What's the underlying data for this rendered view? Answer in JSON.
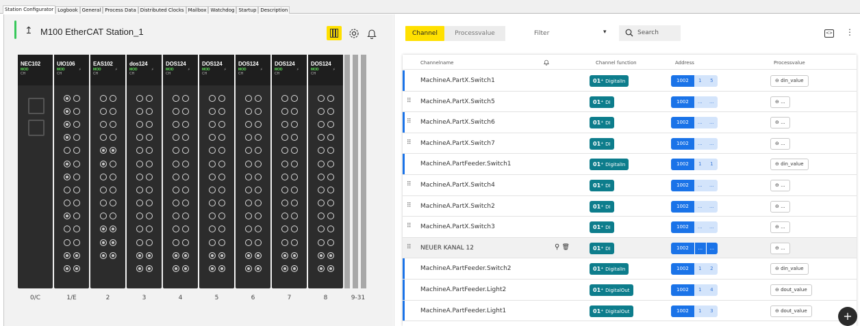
{
  "tabs": [
    "Station Configurator",
    "Logbook",
    "General",
    "Process Data",
    "Distributed Clocks",
    "Mailbox",
    "Watchdog",
    "Startup",
    "Description"
  ],
  "station": {
    "title": "M100 EtherCAT Station_1"
  },
  "modules": [
    {
      "name": "NEC102",
      "mod": "MOD",
      "ch": "CH",
      "slot": "0/C",
      "kind": "coupler"
    },
    {
      "name": "UIO106",
      "mod": "MOD",
      "ch": "CH",
      "slot": "1/E",
      "leds": [
        1,
        0,
        1,
        0,
        1,
        0,
        1,
        0,
        0,
        0,
        1,
        0,
        1,
        0,
        0,
        0,
        0,
        0,
        1,
        0,
        0,
        0,
        0,
        0,
        1,
        1,
        1,
        1
      ]
    },
    {
      "name": "EAS102",
      "mod": "MOD",
      "ch": "CH",
      "slot": "2",
      "leds": [
        0,
        0,
        0,
        0,
        0,
        0,
        0,
        0,
        1,
        1,
        1,
        0,
        0,
        0,
        0,
        0,
        0,
        0,
        0,
        0,
        1,
        1,
        1,
        1,
        1,
        1
      ]
    },
    {
      "name": "dos124",
      "mod": "MOD",
      "ch": "CH",
      "slot": "3",
      "leds": [
        0,
        0,
        0,
        0,
        0,
        0,
        0,
        0,
        0,
        0,
        0,
        0,
        0,
        0,
        0,
        0,
        0,
        0,
        0,
        0,
        0,
        0,
        0,
        0,
        1,
        1,
        1,
        1
      ]
    },
    {
      "name": "DOS124",
      "mod": "MOD",
      "ch": "CH",
      "slot": "4",
      "leds": [
        0,
        0,
        0,
        0,
        0,
        0,
        0,
        0,
        0,
        0,
        0,
        0,
        0,
        0,
        0,
        0,
        0,
        0,
        0,
        0,
        0,
        0,
        0,
        0,
        1,
        1,
        1,
        1
      ]
    },
    {
      "name": "DOS124",
      "mod": "MOD",
      "ch": "CH",
      "slot": "5",
      "leds": [
        0,
        0,
        0,
        0,
        0,
        0,
        0,
        0,
        0,
        0,
        0,
        0,
        0,
        0,
        0,
        0,
        0,
        0,
        0,
        0,
        0,
        0,
        0,
        0,
        1,
        1,
        1,
        1
      ]
    },
    {
      "name": "DOS124",
      "mod": "MOD",
      "ch": "CH",
      "slot": "6",
      "leds": [
        0,
        0,
        0,
        0,
        0,
        0,
        0,
        0,
        0,
        0,
        0,
        0,
        0,
        0,
        0,
        0,
        0,
        0,
        0,
        0,
        0,
        0,
        0,
        0,
        1,
        1,
        1,
        1
      ]
    },
    {
      "name": "DOS124",
      "mod": "MOD",
      "ch": "CH",
      "slot": "7",
      "leds": [
        0,
        0,
        0,
        0,
        0,
        0,
        0,
        0,
        0,
        0,
        0,
        0,
        0,
        0,
        0,
        0,
        0,
        0,
        0,
        0,
        0,
        0,
        0,
        0,
        1,
        1,
        1,
        1
      ]
    },
    {
      "name": "DOS124",
      "mod": "MOD",
      "ch": "CH",
      "slot": "8",
      "leds": [
        0,
        0,
        0,
        0,
        0,
        0,
        0,
        0,
        0,
        0,
        0,
        0,
        0,
        0,
        0,
        0,
        0,
        0,
        0,
        0,
        0,
        0,
        0,
        0,
        1,
        1,
        1,
        1
      ]
    }
  ],
  "empty_slots_label": "9-31",
  "toolbar": {
    "channel": "Channel",
    "processvalue": "Processvalue",
    "filter": "Filter",
    "search_placeholder": "Search"
  },
  "table": {
    "headers": {
      "name": "Channelname",
      "function": "Channel function",
      "address": "Address",
      "processvalue": "Processvalue"
    },
    "rows": [
      {
        "name": "MachineA.PartX.Switch1",
        "fn": "DigitalIn",
        "addr": "1002",
        "a1": "1",
        "a2": "5",
        "pv": "din_value",
        "bar": true,
        "drag": false,
        "sel": false
      },
      {
        "name": "MachineA.PartX.Switch5",
        "fn": "DI",
        "addr": "1002",
        "a1": "...",
        "a2": "...",
        "pv": "...",
        "bar": false,
        "drag": true,
        "sel": false
      },
      {
        "name": "MachineA.PartX.Switch6",
        "fn": "DI",
        "addr": "1002",
        "a1": "...",
        "a2": "...",
        "pv": "...",
        "bar": true,
        "drag": true,
        "sel": false
      },
      {
        "name": "MachineA.PartX.Switch7",
        "fn": "DI",
        "addr": "1002",
        "a1": "...",
        "a2": "...",
        "pv": "...",
        "bar": false,
        "drag": true,
        "sel": false
      },
      {
        "name": "MachineA.PartFeeder.Switch1",
        "fn": "DigitalIn",
        "addr": "1002",
        "a1": "1",
        "a2": "1",
        "pv": "din_value",
        "bar": true,
        "drag": false,
        "sel": false
      },
      {
        "name": "MachineA.PartX.Switch4",
        "fn": "DI",
        "addr": "1002",
        "a1": "...",
        "a2": "...",
        "pv": "...",
        "bar": false,
        "drag": true,
        "sel": false
      },
      {
        "name": "MachineA.PartX.Switch2",
        "fn": "DI",
        "addr": "1002",
        "a1": "...",
        "a2": "...",
        "pv": "...",
        "bar": false,
        "drag": true,
        "sel": false
      },
      {
        "name": "MachineA.PartX.Switch3",
        "fn": "DI",
        "addr": "1002",
        "a1": "...",
        "a2": "...",
        "pv": "...",
        "bar": false,
        "drag": true,
        "sel": false
      },
      {
        "name": "NEUER KANAL 12",
        "fn": "DI",
        "addr": "1002",
        "a1": "...",
        "a2": "...",
        "pv": "...",
        "bar": false,
        "drag": true,
        "sel": true
      },
      {
        "name": "MachineA.PartFeeder.Switch2",
        "fn": "DigitalIn",
        "addr": "1002",
        "a1": "1",
        "a2": "2",
        "pv": "din_value",
        "bar": true,
        "drag": false,
        "sel": false
      },
      {
        "name": "MachineA.PartFeeder.Light2",
        "fn": "DigitalOut",
        "addr": "1002",
        "a1": "1",
        "a2": "4",
        "pv": "dout_value",
        "bar": true,
        "drag": false,
        "sel": false
      },
      {
        "name": "MachineA.PartFeeder.Light1",
        "fn": "DigitalOut",
        "addr": "1002",
        "a1": "1",
        "a2": "3",
        "pv": "dout_value",
        "bar": true,
        "drag": false,
        "sel": false
      }
    ]
  },
  "colors": {
    "accent": "#ffe000",
    "teal": "#0d7d8c",
    "blue": "#1a73e8",
    "green": "#37c85a"
  }
}
